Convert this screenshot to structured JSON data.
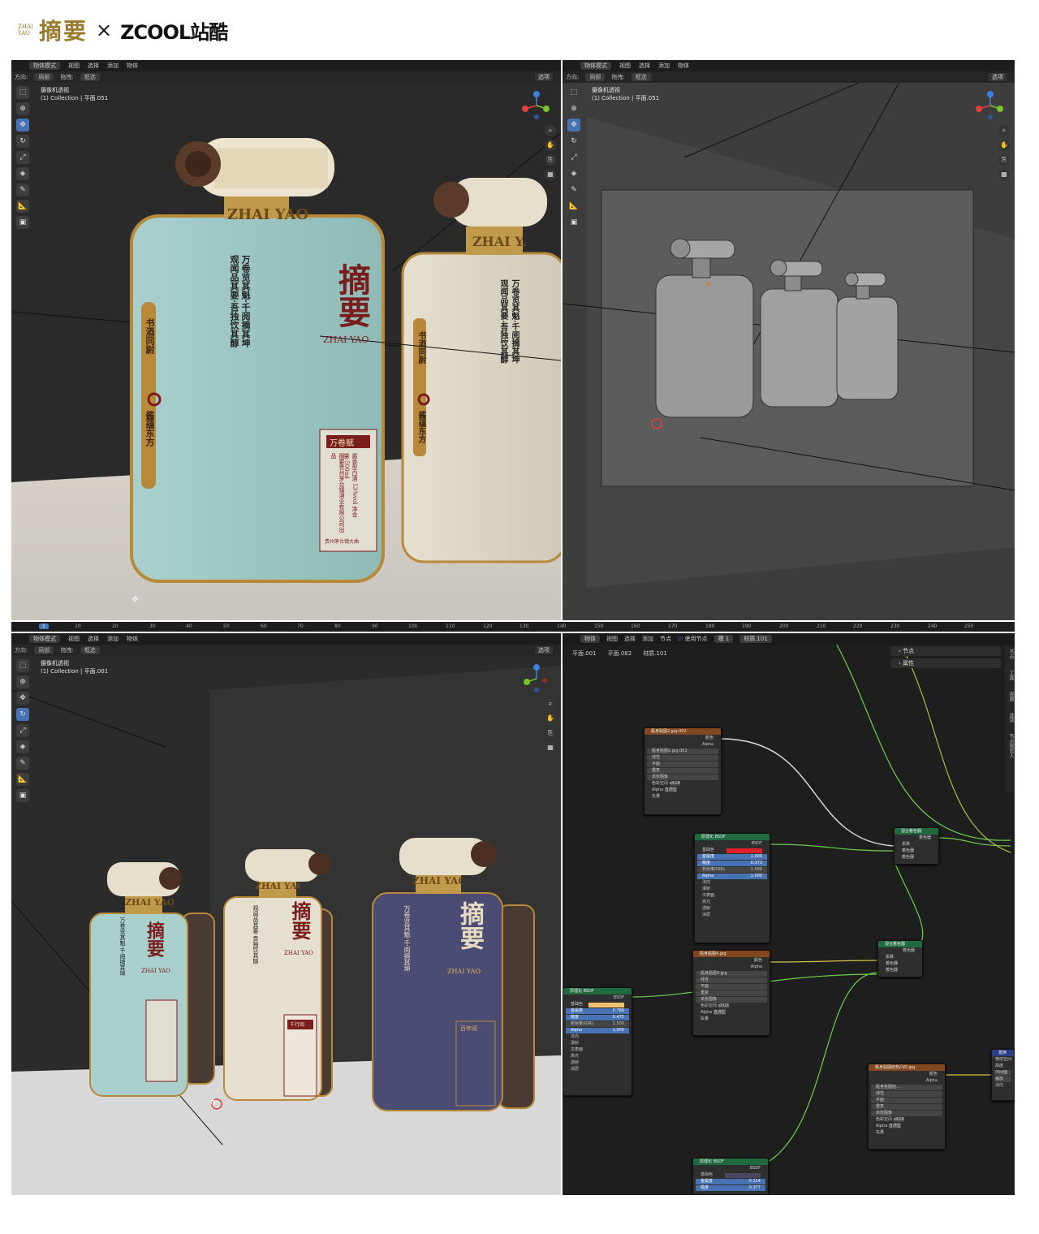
{
  "brand": {
    "logo_sub": "ZHAI YAO",
    "logo_zh": "摘要",
    "cross": "×",
    "zcool": "ZCOOL",
    "zcool_zh": "站酷"
  },
  "viewport": {
    "mode": "物体模式",
    "menus": [
      "视图",
      "选择",
      "添加",
      "物体"
    ],
    "orient_label": "方向:",
    "orient_value": "局部",
    "drag_label": "拖拽:",
    "drag_value": "框选",
    "options": "选项",
    "camera_view": "摄像机透视",
    "collection_tl": "(1) Collection | 平面.051",
    "collection_tr": "(1) Collection | 平面.051",
    "collection_bl": "(1) Collection | 平面.001"
  },
  "bottle": {
    "brand_zh": "摘要",
    "brand_en": "ZHAI YAO",
    "neck": "ZHAI YAO",
    "poem_col1": "万卷览其魁·千阅摘其坤",
    "poem_col2": "观闻品其要·吾独饮其醇",
    "side_top": "书酒同尉",
    "side_bottom": "酱蕴东方",
    "label_tl": "万卷赋",
    "label_bl2": "千行阅",
    "label_bl3": "百年阅",
    "label_small": "摘要贵州茅台镇酒业有限公司出品",
    "label_spec": "酱香型白酒 53%vol 净含量:500ml",
    "label_foot": "贵州茅台镇大曲"
  },
  "timeline": {
    "current": "1",
    "ticks": [
      "10",
      "20",
      "30",
      "40",
      "50",
      "60",
      "70",
      "80",
      "90",
      "100",
      "110",
      "120",
      "130",
      "140",
      "150",
      "160",
      "170",
      "180",
      "190",
      "200",
      "210",
      "220",
      "230",
      "240",
      "250"
    ]
  },
  "node_editor": {
    "header": [
      "物体",
      "视图",
      "选择",
      "添加",
      "节点"
    ],
    "use_nodes": "使用节点",
    "slot": "槽 1",
    "material": "材质.101",
    "breadcrumb": [
      "平面.001",
      "平面.082",
      "材质.101"
    ],
    "panel_node": "节点",
    "panel_props": "属性",
    "side_tabs": [
      "节点",
      "工具",
      "视图",
      "选项",
      "节点预览人"
    ],
    "img1": {
      "title": "瓶身贴图2.jpg.002",
      "out_color": "颜色",
      "out_alpha": "Alpha",
      "file": "瓶身贴图2.jpg.002",
      "rows": [
        "线性",
        "平面",
        "重复",
        "单张图像"
      ],
      "cs_label": "色彩空间",
      "cs_value": "sRGB",
      "alpha_label": "Alpha",
      "alpha_value": "直通型",
      "vec": "矢量"
    },
    "bsdf1": {
      "title": "原理化 BSDF",
      "out": "BSDF",
      "base": "基础色",
      "rows": [
        [
          "金属度",
          "1.000"
        ],
        [
          "糙度",
          "0.373"
        ],
        [
          "折射率(IOR)",
          "1.500"
        ],
        [
          "Alpha",
          "1.000"
        ]
      ],
      "subs": [
        "法向",
        "漫射",
        "次表面",
        "高光",
        "透射",
        "涂层",
        "边缘光泽",
        "自发光",
        "薄膜"
      ]
    },
    "mix1": {
      "title": "混合着色器",
      "out": "着色器",
      "rows": [
        "系数",
        "着色器",
        "着色器"
      ]
    },
    "img2": {
      "title": "瓶身贴图4.jpg",
      "out_color": "颜色",
      "out_alpha": "Alpha",
      "file": "瓶身贴图4.jpg",
      "rows": [
        "线性",
        "平面",
        "重复",
        "单张图像"
      ],
      "cs_label": "色彩空间",
      "cs_value": "sRGB",
      "alpha_label": "Alpha",
      "alpha_value": "直通型",
      "vec": "矢量"
    },
    "mix2": {
      "title": "混合着色器",
      "out": "着色器",
      "rows": [
        "系数",
        "着色器",
        "着色器"
      ]
    },
    "bsdf2": {
      "title": "原理化 BSDF",
      "out": "BSDF",
      "base": "基础色",
      "rows": [
        [
          "金属度",
          "0.789"
        ],
        [
          "糙度",
          "0.475"
        ],
        [
          "折射率(IOR)",
          "1.500"
        ],
        [
          "Alpha",
          "1.000"
        ]
      ],
      "subs": [
        "法向",
        "漫射",
        "次表面",
        "高光",
        "透射",
        "涂层",
        "边缘光泽",
        "自发光",
        "薄膜"
      ]
    },
    "img3": {
      "title": "瓶身贴图结构凸凹.jpg",
      "out_color": "颜色",
      "out_alpha": "Alpha",
      "file": "瓶身贴图结...",
      "rows": [
        "线性",
        "平面",
        "重复",
        "单张图像"
      ],
      "cs_label": "色彩空间",
      "cs_value": "sRGB",
      "alpha_label": "Alpha",
      "alpha_value": "直通型",
      "vec": "矢量"
    },
    "bump": {
      "title": "置换",
      "rows": [
        "物体空间",
        "高度",
        "中间值",
        "缩放",
        "法向"
      ]
    },
    "bsdf3": {
      "title": "原理化 BSDF",
      "out": "BSDF",
      "base": "基础色",
      "rows": [
        [
          "金属度",
          "0.114"
        ],
        [
          "糙度",
          "0.377"
        ]
      ]
    }
  },
  "colors": {
    "teal": "#9cc7c4",
    "cream": "#ddd7c6",
    "navy": "#4a4c73",
    "gold": "#b8893a",
    "red": "#7a1d1d"
  }
}
